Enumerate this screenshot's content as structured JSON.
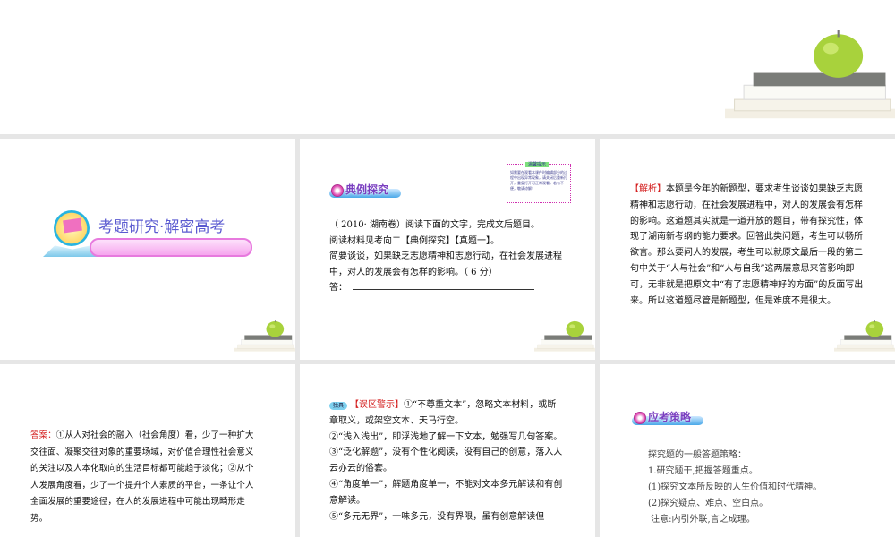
{
  "slide1": {
    "title": "考题研究·解密高考"
  },
  "slide2": {
    "banner": "典例探究",
    "tip_title": "温馨提示",
    "tip_text": "如需要在观看本课件时编辑部分的过程中出现异常现象，请关闭后重新打开，重复打开可正常观看，若有不便，敬请谅解！",
    "lines": [
      "（ 2010· 湖南卷）阅读下面的文字，完成文后题目。",
      "阅读材料见考向二【典例探究】【真题一】。",
      "简要谈谈，如果缺乏志愿精神和志愿行动，在社会发展进程",
      "中，对人的发展会有怎样的影响。（ 6 分）"
    ],
    "answer_label": "答："
  },
  "slide3": {
    "label": "【解析】",
    "text": "本题是今年的新题型，要求考生谈谈如果缺乏志愿精神和志愿行动，在社会发展进程中，对人的发展会有怎样的影响。这道题其实就是一道开放的题目，带有探究性，体现了湖南新考纲的能力要求。回答此类问题，考生可以畅所欲言。那么要问人的发展，考生可以就原文最后一段的第二句中关于“人与社会”和“人与自我”这两层意思来答影响即可，无非就是把原文中“有了志愿精神好的方面”的反面写出来。所以这道题尽管是新题型，但是难度不是很大。"
  },
  "slide4": {
    "label": "答案：",
    "text": "①从人对社会的融入（社会角度）看，少了一种扩大交往面、凝聚交往对象的重要场域，对价值合理性社会意义的关注以及人本化取向的生活目标都可能趋于淡化；②从个人发展角度看，少了一个提升个人素质的平台，一条让个人全面发展的重要途径，在人的发展进程中可能出现畸形走势。"
  },
  "slide5": {
    "badge": "独具",
    "label": "【误区警示】",
    "paras": [
      "①“不尊重文本”，忽略文本材料，或断章取义，或架空文本、天马行空。",
      "②“浅入浅出”，即浮浅地了解一下文本，勉强写几句答案。",
      "③“泛化解题”，没有个性化阅读，没有自己的创意，落入人云亦云的俗套。",
      "④“角度单一”，解题角度单一，不能对文本多元解读和有创意解读。",
      "⑤“多元无界”，一味多元，没有界限，虽有创意解读但"
    ]
  },
  "slide6": {
    "banner": "应考策略",
    "lines": [
      "探究题的一般答题策略：",
      "1.研究题干,把握答题重点。",
      "(1)探究文本所反映的人生价值和时代精神。",
      "(2)探究疑点、难点、空白点。",
      " 注意:内引外联,言之成理。"
    ]
  }
}
